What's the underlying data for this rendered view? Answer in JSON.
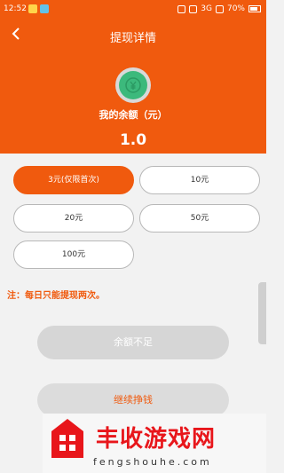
{
  "status_bar": {
    "time": "12:52",
    "network": "3G",
    "battery": "70%"
  },
  "header": {
    "title": "提现详情",
    "balance_label": "我的余额（元）",
    "balance_value": "1.0"
  },
  "options": [
    {
      "label": "3元(仅限首次)",
      "selected": true
    },
    {
      "label": "10元",
      "selected": false
    },
    {
      "label": "20元",
      "selected": false
    },
    {
      "label": "50元",
      "selected": false
    },
    {
      "label": "100元",
      "selected": false
    }
  ],
  "note": "注：每日只能提现两次。",
  "buttons": {
    "insufficient": "余额不足",
    "continue": "继续挣钱"
  },
  "watermark": {
    "brand": "丰收游戏网",
    "url": "fengshouhe.com"
  },
  "colors": {
    "accent": "#f05a0e",
    "coin": "#3cb97c"
  },
  "icons": {
    "back": "chevron-left-icon",
    "coin": "coin-icon"
  }
}
